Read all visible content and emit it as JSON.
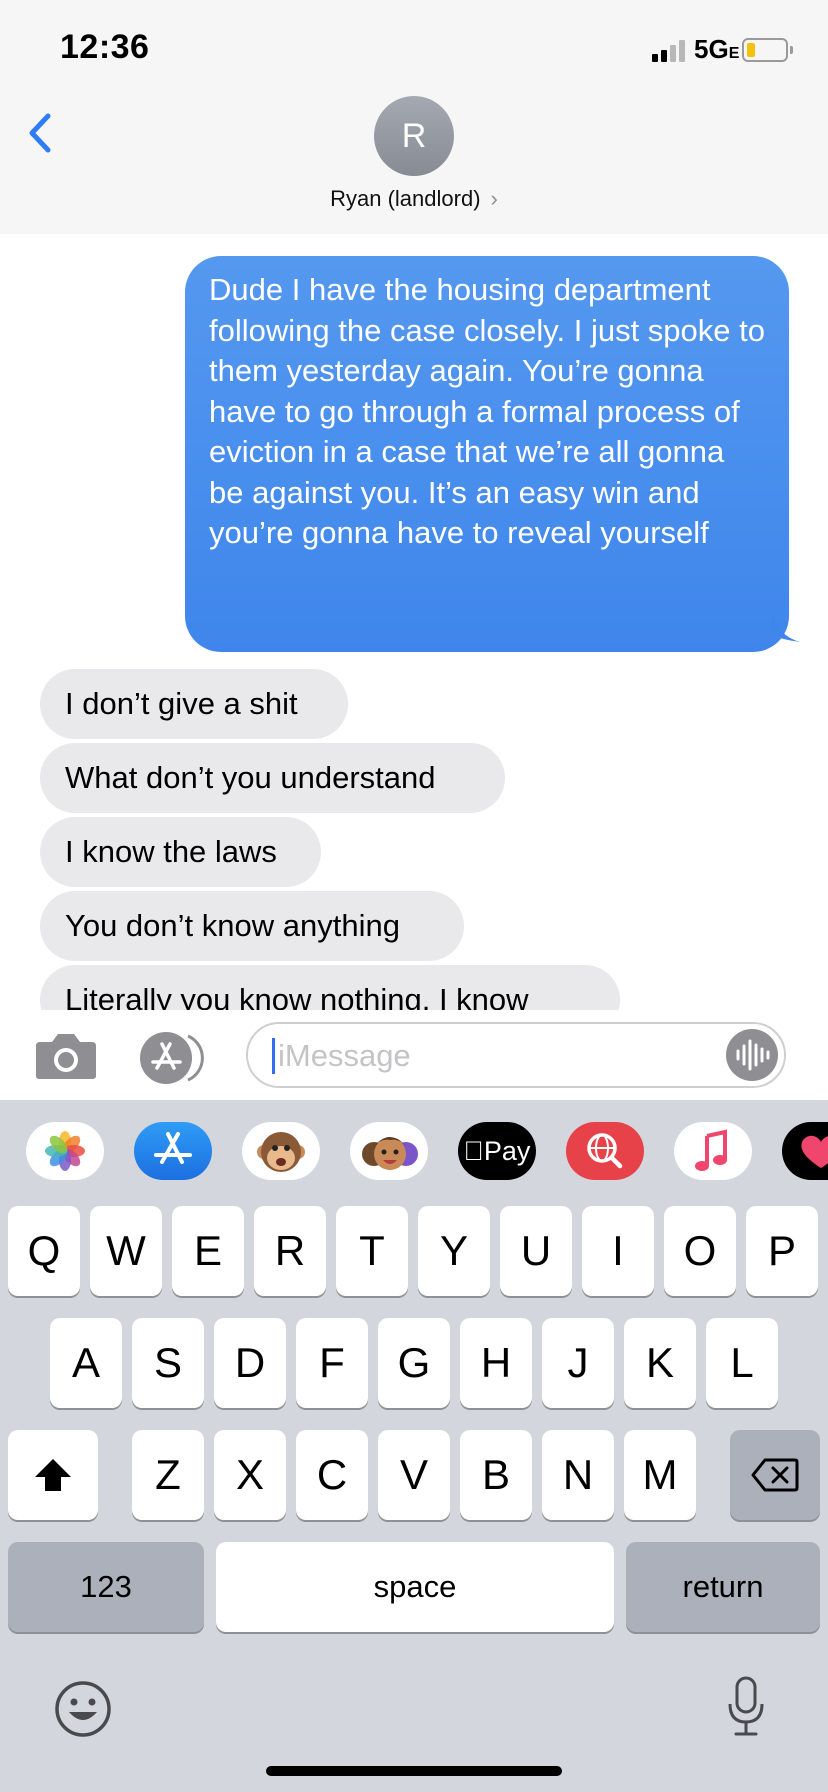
{
  "status_bar": {
    "time": "12:36",
    "network": "5G",
    "network_suffix": "E"
  },
  "header": {
    "avatar_initial": "R",
    "contact_name": "Ryan (landlord)",
    "chevron": "›"
  },
  "messages": {
    "sent": [
      {
        "text": "Dude I have the housing department following the case closely. I just spoke to them yesterday again. You’re gonna have to go through a formal process of eviction in a case that we’re all gonna be against you. It’s an easy win and you’re gonna have to reveal yourself"
      }
    ],
    "received": [
      {
        "text": "I don’t give a shit"
      },
      {
        "text": "What don’t you understand"
      },
      {
        "text": "I know the laws"
      },
      {
        "text": "You don’t know anything"
      },
      {
        "text": "Literally you know nothing.  I know"
      }
    ]
  },
  "input": {
    "placeholder": "iMessage"
  },
  "app_drawer": {
    "apps": [
      "photos-icon",
      "app-store-icon",
      "animoji-icon",
      "memoji-icon",
      "apple-pay-icon",
      "web-search-icon",
      "music-icon",
      "digital-touch-icon"
    ],
    "apple_pay_label": "Pay"
  },
  "keyboard": {
    "row1": [
      "Q",
      "W",
      "E",
      "R",
      "T",
      "Y",
      "U",
      "I",
      "O",
      "P"
    ],
    "row2": [
      "A",
      "S",
      "D",
      "F",
      "G",
      "H",
      "J",
      "K",
      "L"
    ],
    "row3": [
      "Z",
      "X",
      "C",
      "V",
      "B",
      "N",
      "M"
    ],
    "numbers_label": "123",
    "space_label": "space",
    "return_label": "return"
  },
  "colors": {
    "sent_bubble": "#3f86ec",
    "received_bubble": "#e9e9eb",
    "accent": "#2f7df6",
    "keyboard_bg": "#d3d6dd"
  }
}
